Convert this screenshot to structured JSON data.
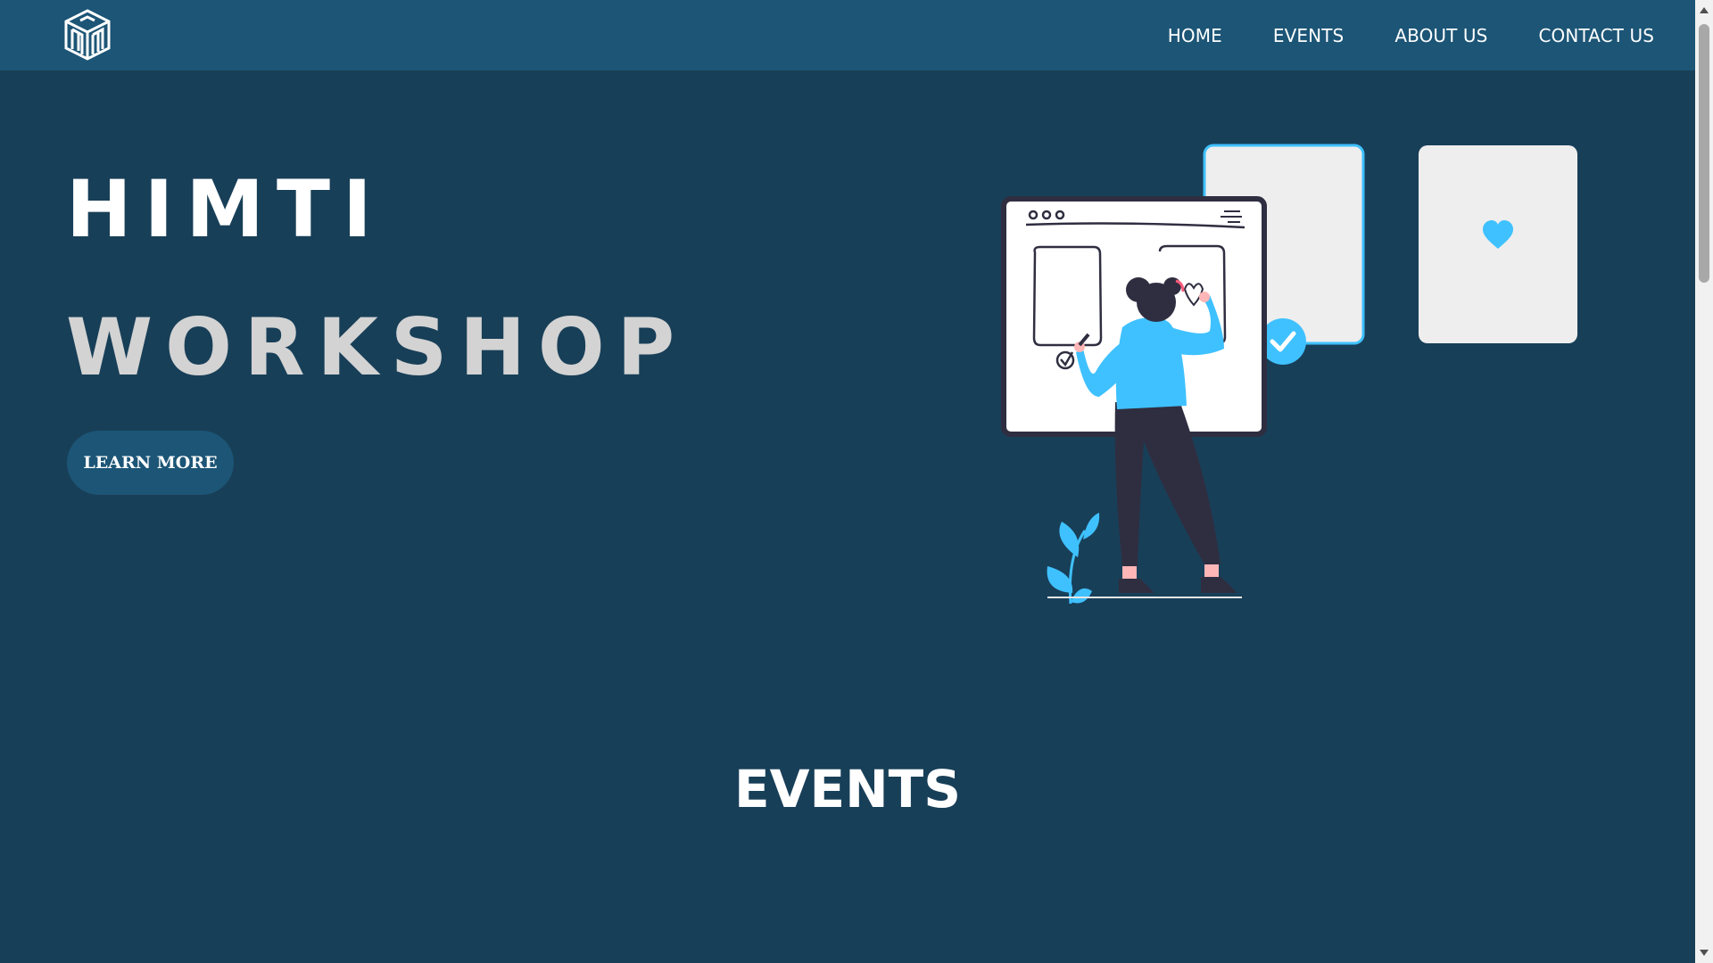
{
  "nav": {
    "items": [
      {
        "label": "HOME"
      },
      {
        "label": "EVENTS"
      },
      {
        "label": "ABOUT US"
      },
      {
        "label": "CONTACT US"
      }
    ]
  },
  "hero": {
    "title_line1": "HIMTI",
    "title_line2": "WORKSHOP",
    "cta_label": "LEARN MORE"
  },
  "events": {
    "heading": "EVENTS"
  },
  "colors": {
    "navbar": "#1c5576",
    "background": "#183f58",
    "accent": "#3fc1ff",
    "title_primary": "#ffffff",
    "title_secondary": "#d3d3d3"
  },
  "icons": {
    "logo": "himti-cube-logo",
    "check": "check-circle-icon",
    "heart": "heart-icon"
  }
}
